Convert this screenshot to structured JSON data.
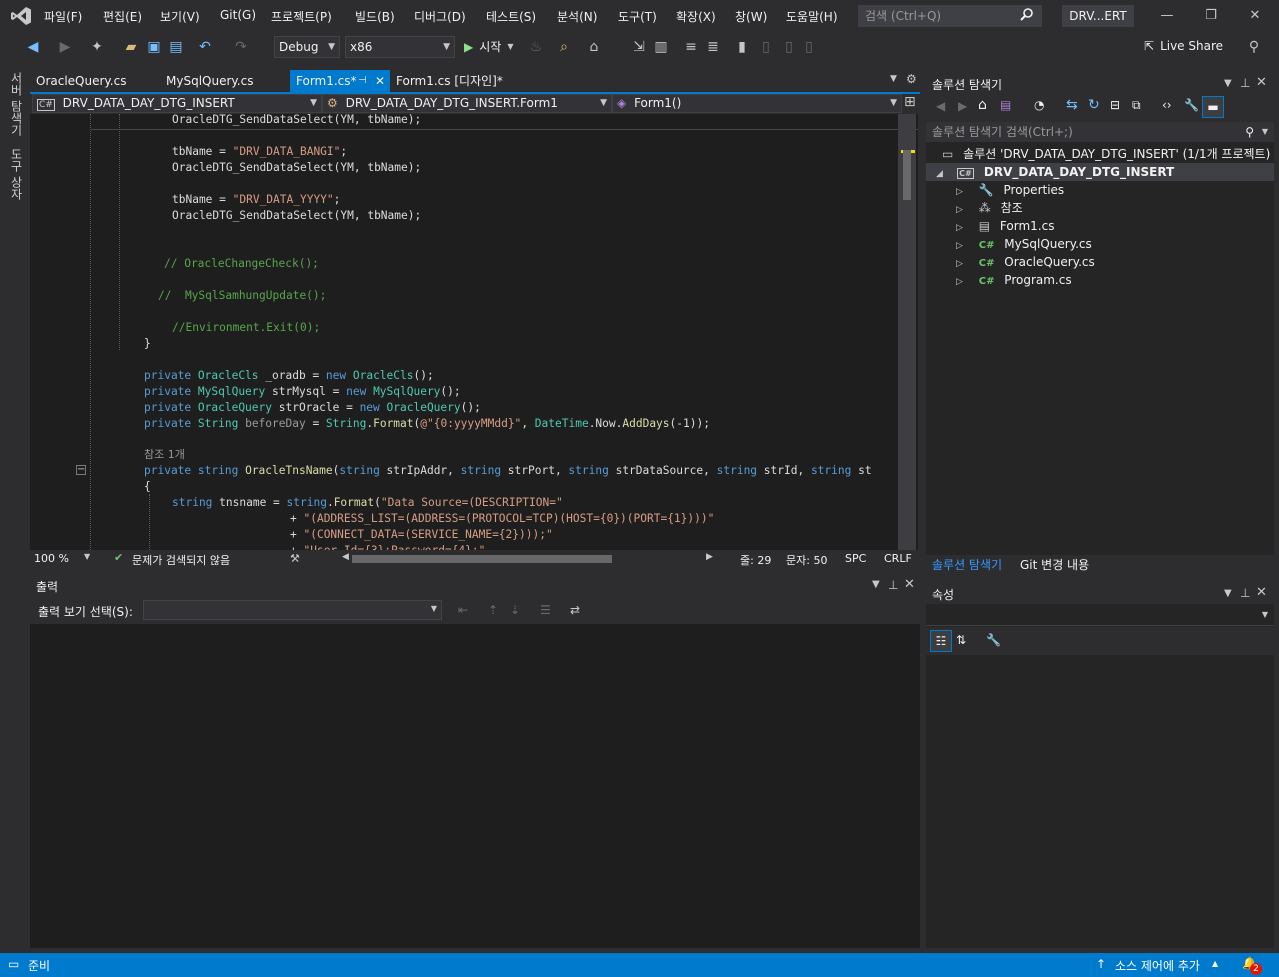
{
  "menubar": {
    "items": [
      "파일(F)",
      "편집(E)",
      "보기(V)",
      "Git(G)",
      "프로젝트(P)",
      "빌드(B)",
      "디버그(D)",
      "테스트(S)",
      "분석(N)",
      "도구(T)",
      "확장(X)",
      "창(W)",
      "도움말(H)"
    ],
    "search_placeholder": "검색 (Ctrl+Q)",
    "solution_name": "DRV...ERT"
  },
  "toolbar": {
    "config": "Debug",
    "platform": "x86",
    "start_label": "시작",
    "liveshare_label": "Live Share"
  },
  "left_strip": {
    "tab1": "서버 탐색기",
    "tab2": "도구 상자"
  },
  "doc_tabs": {
    "tab1": "OracleQuery.cs",
    "tab2": "MySqlQuery.cs",
    "tab3": "Form1.cs*",
    "tab4": "Form1.cs [디자인]*"
  },
  "navbar": {
    "project": "DRV_DATA_DAY_DTG_INSERT",
    "class": "DRV_DATA_DAY_DTG_INSERT.Form1",
    "member": "Form1()"
  },
  "editor": {
    "ref_count": "참조 1개"
  },
  "editor_status": {
    "zoom": "100 %",
    "issues": "문제가 검색되지 않음",
    "line": "줄: 29",
    "col": "문자: 50",
    "spc": "SPC",
    "crlf": "CRLF"
  },
  "output": {
    "title": "출력",
    "select_label": "출력 보기 선택(S):"
  },
  "solution_explorer": {
    "title": "솔루션 탐색기",
    "search_placeholder": "솔루션 탐색기 검색(Ctrl+;)",
    "solution_line": "솔루션 'DRV_DATA_DAY_DTG_INSERT' (1/1개 프로젝트)",
    "project": "DRV_DATA_DAY_DTG_INSERT",
    "items": [
      "Properties",
      "참조",
      "Form1.cs",
      "MySqlQuery.cs",
      "OracleQuery.cs",
      "Program.cs"
    ],
    "bottom_tab1": "솔루션 탐색기",
    "bottom_tab2": "Git 변경 내용"
  },
  "properties": {
    "title": "속성"
  },
  "statusbar": {
    "ready": "준비",
    "source_control": "소스 제어에 추가",
    "notification_count": "2"
  },
  "colors": {
    "accent": "#007acc",
    "editor_bg": "#1e1e1e",
    "chrome_bg": "#2d2d30"
  }
}
